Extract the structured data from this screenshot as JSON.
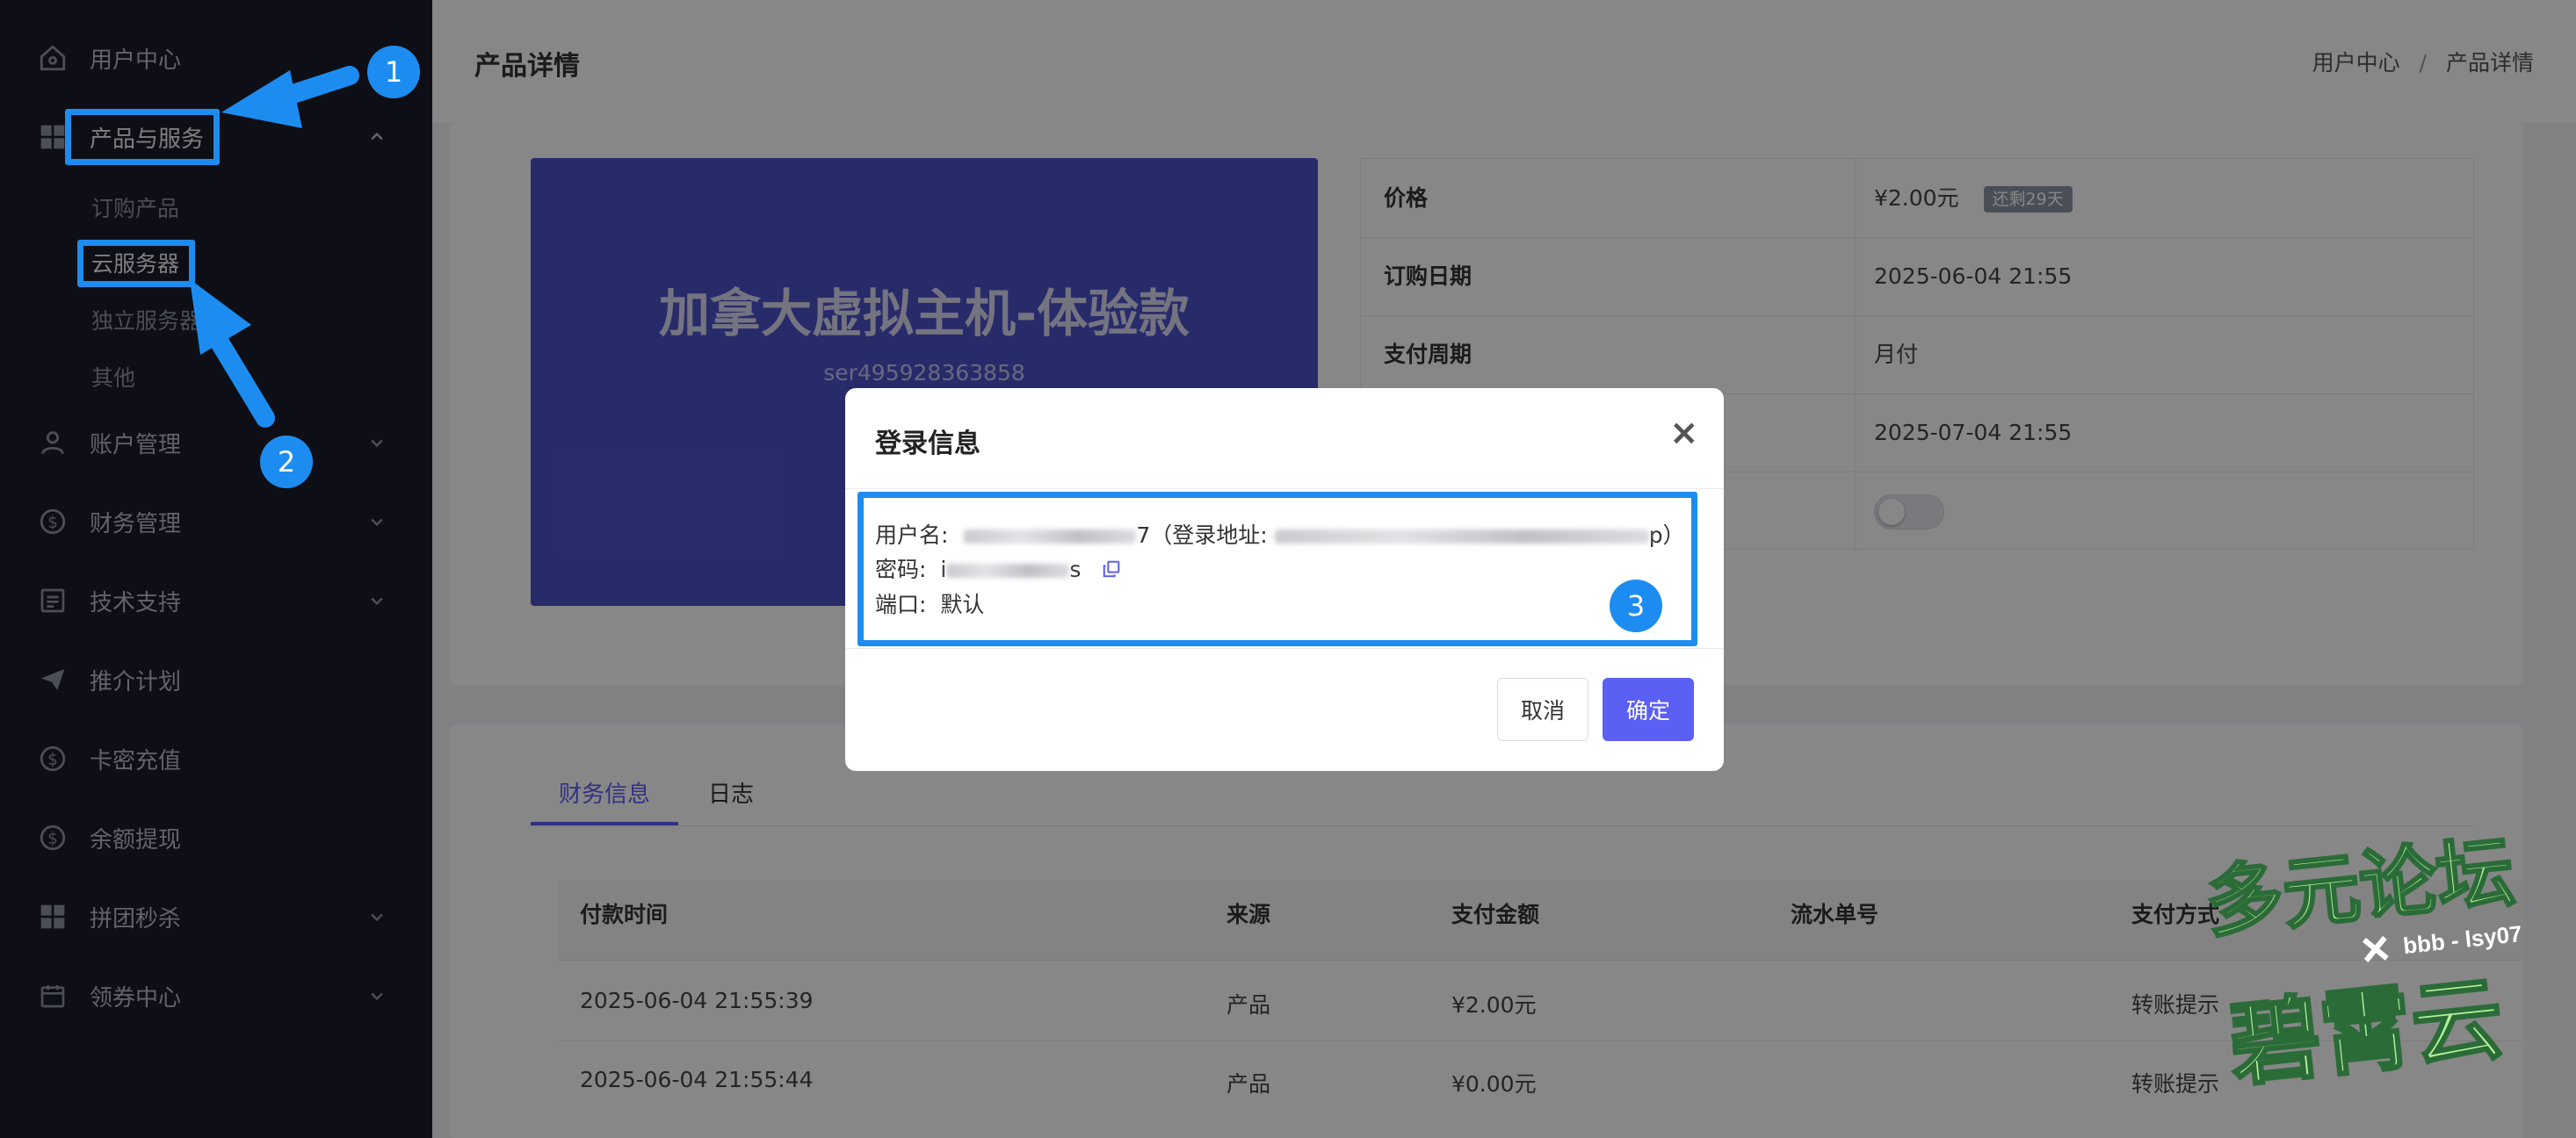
{
  "sidebar": {
    "items": [
      {
        "label": "用户中心",
        "icon": "home-icon"
      },
      {
        "label": "产品与服务",
        "icon": "grid-icon"
      },
      {
        "label": "账户管理",
        "icon": "user-icon"
      },
      {
        "label": "财务管理",
        "icon": "dollar-circle-icon"
      },
      {
        "label": "技术支持",
        "icon": "document-icon"
      },
      {
        "label": "推介计划",
        "icon": "paper-plane-icon"
      },
      {
        "label": "卡密充值",
        "icon": "dollar-circle-icon"
      },
      {
        "label": "余额提现",
        "icon": "dollar-circle-icon"
      },
      {
        "label": "拼团秒杀",
        "icon": "grid-icon"
      },
      {
        "label": "领券中心",
        "icon": "calendar-icon"
      }
    ],
    "sub_items": [
      "订购产品",
      "云服务器",
      "独立服务器",
      "其他"
    ]
  },
  "header": {
    "page_title": "产品详情",
    "breadcrumb": [
      "用户中心",
      "/",
      "产品详情"
    ]
  },
  "product": {
    "name": "加拿大虚拟主机-体验款",
    "id": "ser495928363858",
    "details": [
      {
        "key": "价格",
        "value": "¥2.00元",
        "badge": "还剩29天"
      },
      {
        "key": "订购日期",
        "value": "2025-06-04 21:55"
      },
      {
        "key": "支付周期",
        "value": "月付"
      },
      {
        "key": "",
        "value": "2025-07-04 21:55"
      }
    ]
  },
  "tabs": [
    "财务信息",
    "日志"
  ],
  "table": {
    "headers": [
      "付款时间",
      "来源",
      "支付金额",
      "流水单号",
      "支付方式"
    ],
    "rows": [
      [
        "2025-06-04 21:55:39",
        "产品",
        "¥2.00元",
        "",
        "转账提示"
      ],
      [
        "2025-06-04 21:55:44",
        "产品",
        "¥0.00元",
        "",
        "转账提示"
      ]
    ]
  },
  "modal": {
    "title": "登录信息",
    "close": "×",
    "username_label": "用户名:",
    "username_tail": "7",
    "login_addr_label": "（登录地址:",
    "login_addr_tail": "p）",
    "password_label": "密码:",
    "password_lead": "i",
    "password_tail": "s",
    "port_label": "端口:",
    "port_value": "默认",
    "cancel": "取消",
    "confirm": "确定"
  },
  "annotations": [
    "1",
    "2",
    "3"
  ],
  "watermark": {
    "line1": "多元论坛",
    "cross": "×",
    "sub": "bbb - lsy07",
    "line2": "碧霄云"
  },
  "colors": {
    "sidebar_bg": "#1b1d2a",
    "accent": "#5b5ff4",
    "product_card": "#4d52c9",
    "annotation_blue": "#1d8cf0",
    "watermark_green": "#b4f29a"
  }
}
